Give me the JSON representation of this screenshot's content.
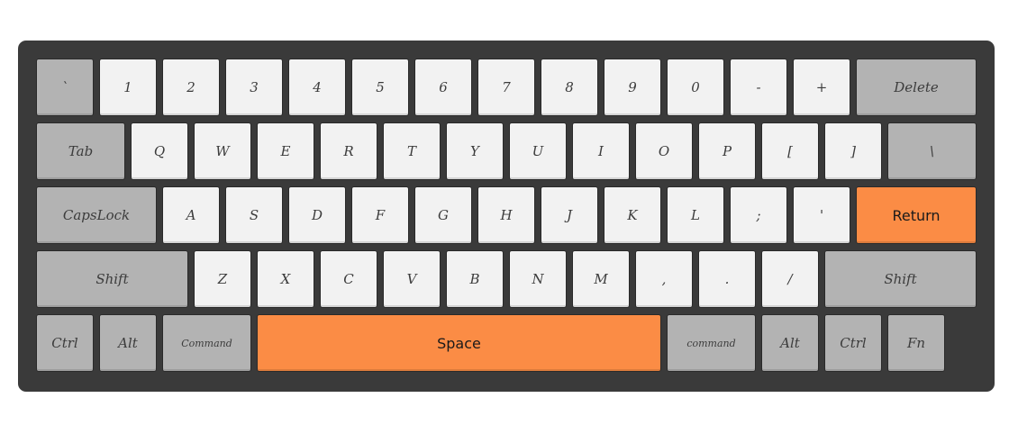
{
  "keyboard": {
    "colors": {
      "frame": "#3a3a3a",
      "light_key": "#f2f2f2",
      "modifier_key": "#b3b3b3",
      "accent_key": "#fb8c45"
    },
    "rows": [
      [
        {
          "label": "`",
          "type": "mod"
        },
        {
          "label": "1",
          "type": "light"
        },
        {
          "label": "2",
          "type": "light"
        },
        {
          "label": "3",
          "type": "light"
        },
        {
          "label": "4",
          "type": "light"
        },
        {
          "label": "5",
          "type": "light"
        },
        {
          "label": "6",
          "type": "light"
        },
        {
          "label": "7",
          "type": "light"
        },
        {
          "label": "8",
          "type": "light"
        },
        {
          "label": "9",
          "type": "light"
        },
        {
          "label": "0",
          "type": "light"
        },
        {
          "label": "-",
          "type": "light"
        },
        {
          "label": "+",
          "type": "light"
        },
        {
          "label": "Delete",
          "type": "mod"
        }
      ],
      [
        {
          "label": "Tab",
          "type": "mod"
        },
        {
          "label": "Q",
          "type": "light"
        },
        {
          "label": "W",
          "type": "light"
        },
        {
          "label": "E",
          "type": "light"
        },
        {
          "label": "R",
          "type": "light"
        },
        {
          "label": "T",
          "type": "light"
        },
        {
          "label": "Y",
          "type": "light"
        },
        {
          "label": "U",
          "type": "light"
        },
        {
          "label": "I",
          "type": "light"
        },
        {
          "label": "O",
          "type": "light"
        },
        {
          "label": "P",
          "type": "light"
        },
        {
          "label": "[",
          "type": "light"
        },
        {
          "label": "]",
          "type": "light"
        },
        {
          "label": "\\",
          "type": "mod"
        }
      ],
      [
        {
          "label": "CapsLock",
          "type": "mod"
        },
        {
          "label": "A",
          "type": "light"
        },
        {
          "label": "S",
          "type": "light"
        },
        {
          "label": "D",
          "type": "light"
        },
        {
          "label": "F",
          "type": "light"
        },
        {
          "label": "G",
          "type": "light"
        },
        {
          "label": "H",
          "type": "light"
        },
        {
          "label": "J",
          "type": "light"
        },
        {
          "label": "K",
          "type": "light"
        },
        {
          "label": "L",
          "type": "light"
        },
        {
          "label": ";",
          "type": "light"
        },
        {
          "label": "'",
          "type": "light"
        },
        {
          "label": "Return",
          "type": "accent"
        }
      ],
      [
        {
          "label": "Shift",
          "type": "mod"
        },
        {
          "label": "Z",
          "type": "light"
        },
        {
          "label": "X",
          "type": "light"
        },
        {
          "label": "C",
          "type": "light"
        },
        {
          "label": "V",
          "type": "light"
        },
        {
          "label": "B",
          "type": "light"
        },
        {
          "label": "N",
          "type": "light"
        },
        {
          "label": "M",
          "type": "light"
        },
        {
          "label": ",",
          "type": "light"
        },
        {
          "label": ".",
          "type": "light"
        },
        {
          "label": "/",
          "type": "light"
        },
        {
          "label": "Shift",
          "type": "mod"
        }
      ],
      [
        {
          "label": "Ctrl",
          "type": "mod"
        },
        {
          "label": "Alt",
          "type": "mod"
        },
        {
          "label": "Command",
          "type": "mod"
        },
        {
          "label": "Space",
          "type": "accent"
        },
        {
          "label": "command",
          "type": "mod"
        },
        {
          "label": "Alt",
          "type": "mod"
        },
        {
          "label": "Ctrl",
          "type": "mod"
        },
        {
          "label": "Fn",
          "type": "mod"
        }
      ]
    ]
  }
}
